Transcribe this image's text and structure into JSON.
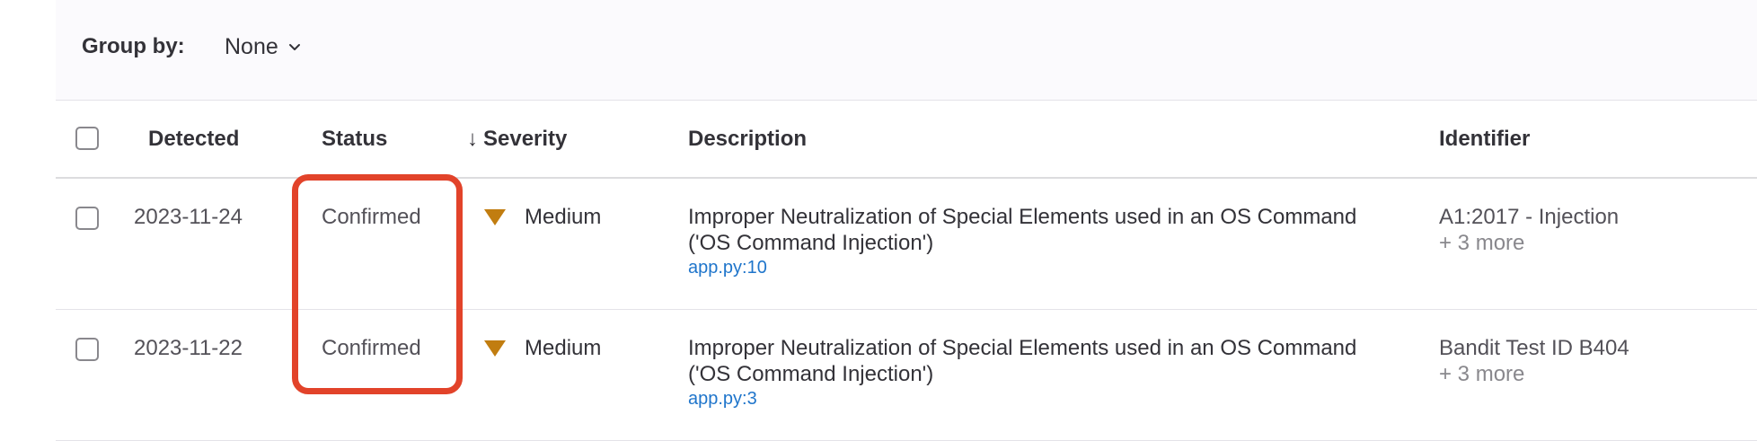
{
  "toolbar": {
    "group_by_label": "Group by:",
    "group_by_value": "None"
  },
  "columns": {
    "detected": "Detected",
    "status": "Status",
    "severity": "Severity",
    "severity_sort_indicator": "↓",
    "description": "Description",
    "identifier": "Identifier"
  },
  "rows": [
    {
      "detected": "2023-11-24",
      "status": "Confirmed",
      "severity": "Medium",
      "description": "Improper Neutralization of Special Elements used in an OS Command ('OS Command Injection')",
      "location": "app.py:10",
      "identifier": "A1:2017 - Injection",
      "identifier_more": "+ 3 more"
    },
    {
      "detected": "2023-11-22",
      "status": "Confirmed",
      "severity": "Medium",
      "description": "Improper Neutralization of Special Elements used in an OS Command ('OS Command Injection')",
      "location": "app.py:3",
      "identifier": "Bandit Test ID B404",
      "identifier_more": "+ 3 more"
    }
  ],
  "colors": {
    "highlight": "#e2432a",
    "severity_medium": "#c17d10",
    "link": "#1f75cb"
  },
  "icons": {
    "severity": "triangle-down-icon",
    "dropdown": "chevron-down-icon"
  }
}
